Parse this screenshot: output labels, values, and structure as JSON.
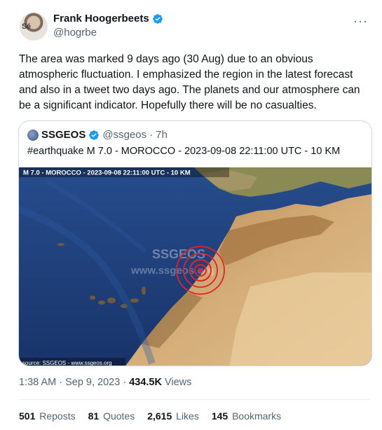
{
  "author": {
    "display_name": "Frank Hoogerbeets",
    "handle": "@hogrbe",
    "avatar_text": "Sé"
  },
  "tweet": {
    "text": "The area was marked 9 days ago (30 Aug) due to an obvious atmospheric fluctuation. I emphasized the region in the latest forecast and also in a tweet two days ago. The planets and our atmosphere can be a significant indicator. Hopefully there will be no casualties."
  },
  "quoted": {
    "name": "SSGEOS",
    "handle": "@ssgeos",
    "separator": "·",
    "time": "7h",
    "text": "#earthquake M 7.0 - MOROCCO - 2023-09-08 22:11:00 UTC - 10 KM",
    "map": {
      "caption": "M 7.0 - MOROCCO - 2023-09-08 22:11:00 UTC - 10 KM",
      "watermark_1": "SSGEOS",
      "watermark_2": "www.ssgeos.org",
      "source": "source: SSGEOS - www.ssgeos.org"
    }
  },
  "meta": {
    "time": "1:38 AM · Sep 9, 2023 ·",
    "views_count": "434.5K",
    "views_label": "Views"
  },
  "stats": {
    "reposts_count": "501",
    "reposts_label": "Reposts",
    "quotes_count": "81",
    "quotes_label": "Quotes",
    "likes_count": "2,615",
    "likes_label": "Likes",
    "bookmarks_count": "145",
    "bookmarks_label": "Bookmarks"
  },
  "colors": {
    "verified": "#1d9bf0",
    "ocean": "#1f3f7a",
    "land": "#c9a06a",
    "epicenter": "#e0222a"
  },
  "icons": [
    "verified-icon",
    "more-icon"
  ]
}
